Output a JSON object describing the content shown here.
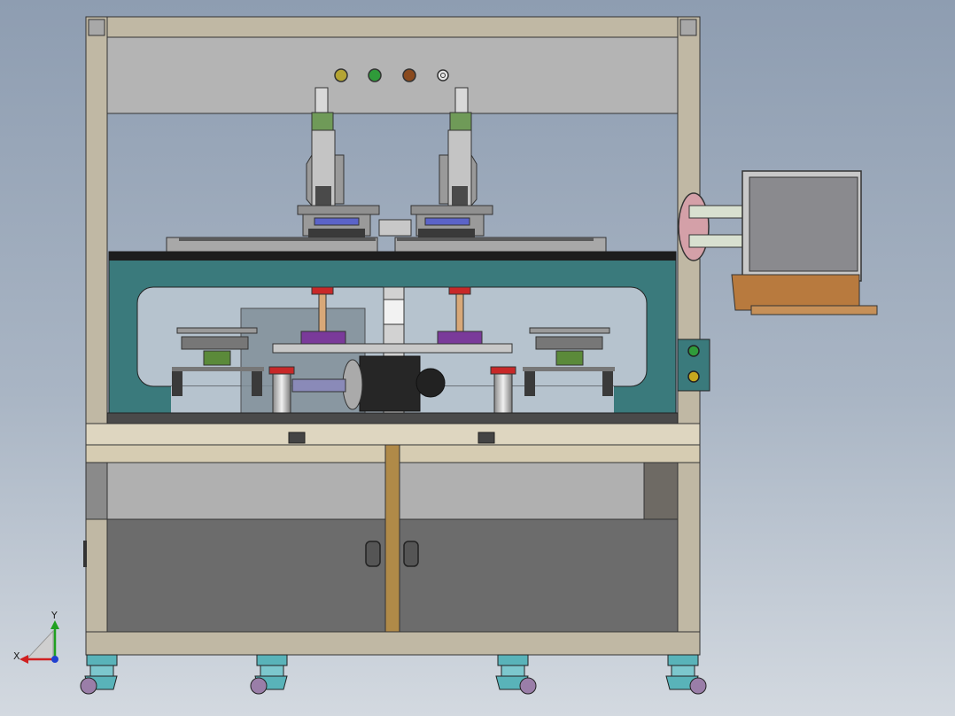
{
  "view": {
    "type": "CAD front view",
    "background_top": "#8e9db1",
    "background_bottom": "#d3d9e0"
  },
  "machine": {
    "frame_color": "#c0b8a4",
    "panel_color": "#b4b4b4",
    "base_color": "#3a7a7c",
    "cabinet_color": "#6c6c6c",
    "cabinet_strip_color": "#b08a48",
    "caster_color": "#59b3b9"
  },
  "indicator_lights": [
    {
      "name": "yellow",
      "color": "#b4a433"
    },
    {
      "name": "green",
      "color": "#2f9b3a"
    },
    {
      "name": "brown",
      "color": "#8a4a1e"
    },
    {
      "name": "white",
      "color": "#e6e6e6"
    }
  ],
  "control_box_buttons": [
    {
      "name": "green",
      "color": "#2f9b3a"
    },
    {
      "name": "yellow",
      "color": "#c6a81e"
    }
  ],
  "monitor": {
    "bezel_color": "#c8c8c8",
    "screen_color": "#8a8a8e",
    "tray_color": "#b87a3e"
  },
  "axis_triad": {
    "x_label": "X",
    "y_label": "Y",
    "x_color": "#d02020",
    "y_color": "#20a020",
    "z_color": "#2040d0"
  }
}
